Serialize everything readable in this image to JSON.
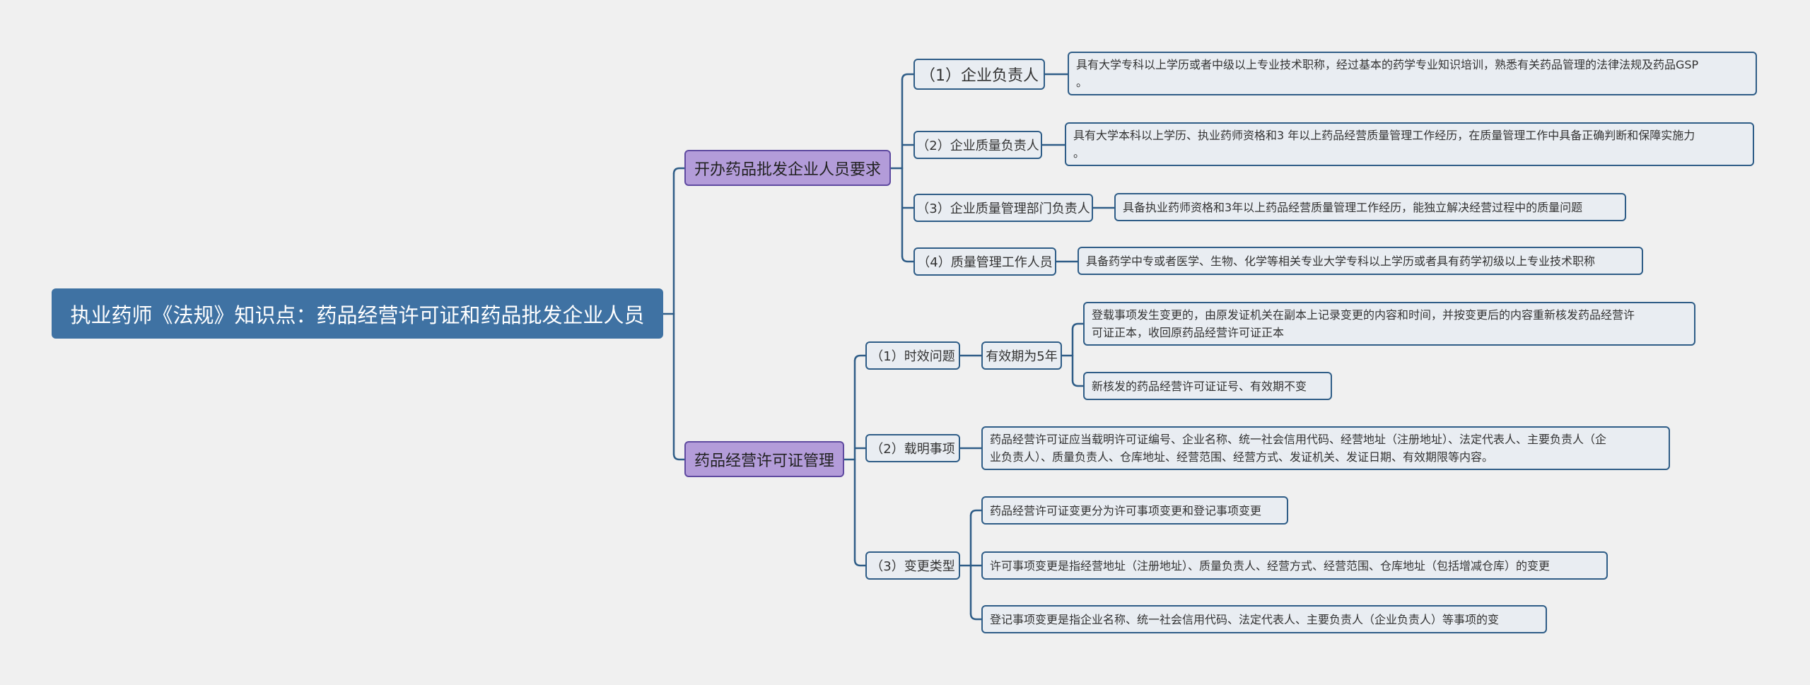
{
  "root": {
    "label": "执业药师《法规》知识点：药品经营许可证和药品批发企业人员"
  },
  "branch_a": {
    "label": "开办药品批发企业人员要求",
    "items": [
      {
        "label": "（1）企业负责人",
        "detail": "具有大学专科以上学历或者中级以上专业技术职称，经过基本的药学专业知识培训，熟悉有关药品管理的法律法规及药品GSP\n。"
      },
      {
        "label": "（2）企业质量负责人",
        "detail": "具有大学本科以上学历、执业药师资格和3 年以上药品经营质量管理工作经历，在质量管理工作中具备正确判断和保障实施力\n。"
      },
      {
        "label": "（3）企业质量管理部门负责人",
        "detail": "具备执业药师资格和3年以上药品经营质量管理工作经历，能独立解决经营过程中的质量问题"
      },
      {
        "label": "（4）质量管理工作人员",
        "detail": "具备药学中专或者医学、生物、化学等相关专业大学专科以上学历或者具有药学初级以上专业技术职称"
      }
    ]
  },
  "branch_b": {
    "label": "药品经营许可证管理",
    "validity": {
      "label": "（1）时效问题",
      "sub": "有效期为5年",
      "details": [
        "登载事项发生变更的，由原发证机关在副本上记录变更的内容和时间，并按变更后的内容重新核发药品经营许\n可证正本，收回原药品经营许可证正本",
        "新核发的药品经营许可证证号、有效期不变"
      ]
    },
    "items_listed": {
      "label": "（2）载明事项",
      "detail": "药品经营许可证应当载明许可证编号、企业名称、统一社会信用代码、经营地址（注册地址）、法定代表人、主要负责人（企\n业负责人）、质量负责人、仓库地址、经营范围、经营方式、发证机关、发证日期、有效期限等内容。"
    },
    "change_types": {
      "label": "（3）变更类型",
      "details": [
        "药品经营许可证变更分为许可事项变更和登记事项变更",
        "许可事项变更是指经营地址（注册地址）、质量负责人、经营方式、经营范围、仓库地址（包括增减仓库）的变更",
        "登记事项变更是指企业名称、统一社会信用代码、法定代表人、主要负责人（企业负责人）等事项的变"
      ]
    }
  }
}
